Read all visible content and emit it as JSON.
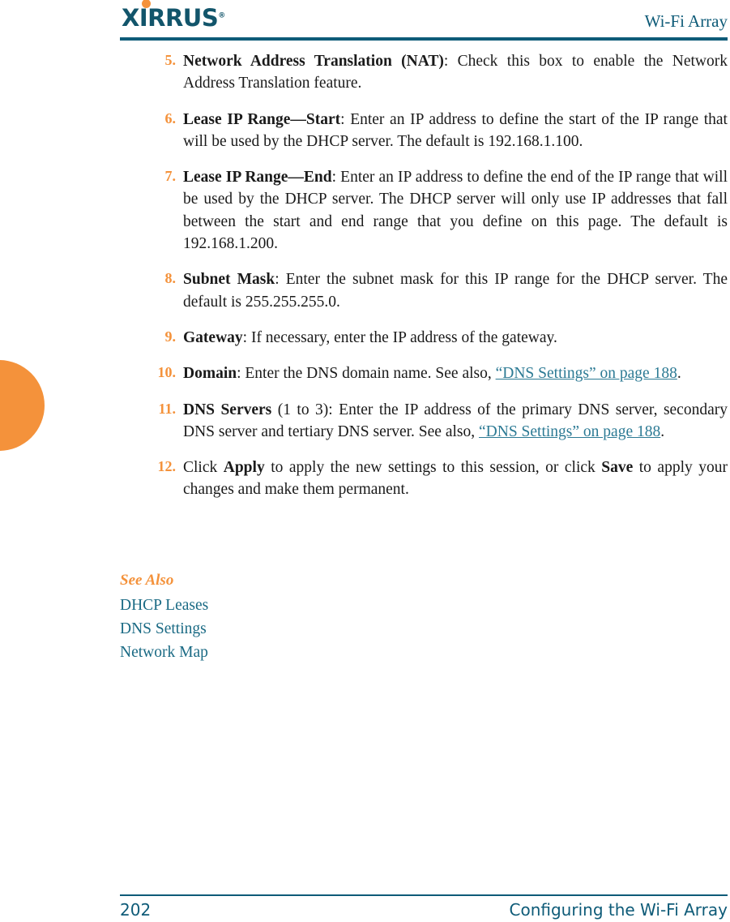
{
  "header": {
    "logo_text": "XIRRUS",
    "logo_trademark": "®",
    "title": "Wi-Fi Array",
    "logo_dot_color": "#F4923B",
    "logo_color": "#12556B",
    "rule_color": "#0E5B78"
  },
  "colors": {
    "orange": "#F4923B",
    "teal": "#0E5B78",
    "link_teal": "#2C7A94",
    "body_text": "#1a1a1a"
  },
  "list": {
    "items": [
      {
        "number": "5.",
        "term": "Network Address Translation (NAT)",
        "body": ": Check this box to enable the Network Address Translation feature."
      },
      {
        "number": "6.",
        "term": "Lease IP Range—Start",
        "body": ": Enter an IP address to define the start of the IP range that will be used by the DHCP server. The default is 192.168.1.100."
      },
      {
        "number": "7.",
        "term": "Lease IP Range—End",
        "body": ": Enter an IP address to define the end of the IP range that will be used by the DHCP server. The DHCP server will only use IP addresses that fall between the start and end range that you define on this page. The default is 192.168.1.200."
      },
      {
        "number": "8.",
        "term": "Subnet Mask",
        "body": ": Enter the subnet mask for this IP range for the DHCP server. The default is 255.255.255.0."
      },
      {
        "number": "9.",
        "term": "Gateway",
        "body": ": If necessary, enter the IP address of the gateway."
      },
      {
        "number": "10.",
        "term": "Domain",
        "body": ": Enter the DNS domain name. See also, ",
        "link": "“DNS Settings” on page 188",
        "body_after": "."
      },
      {
        "number": "11.",
        "term": "DNS Servers",
        "body": " (1 to 3): Enter the IP address of the primary DNS server, secondary DNS server and tertiary DNS server. See also, ",
        "link": "“DNS Settings” on page 188",
        "body_after": "."
      },
      {
        "number": "12.",
        "body_pre": "Click ",
        "term": "Apply",
        "body_mid": " to apply the new settings to this session, or click ",
        "term2": "Save",
        "body_after": " to apply your changes and make them permanent."
      }
    ]
  },
  "see_also": {
    "title": "See Also",
    "links": [
      "DHCP Leases",
      "DNS Settings",
      "Network Map"
    ]
  },
  "footer": {
    "page_number": "202",
    "chapter": "Configuring the Wi-Fi Array"
  }
}
